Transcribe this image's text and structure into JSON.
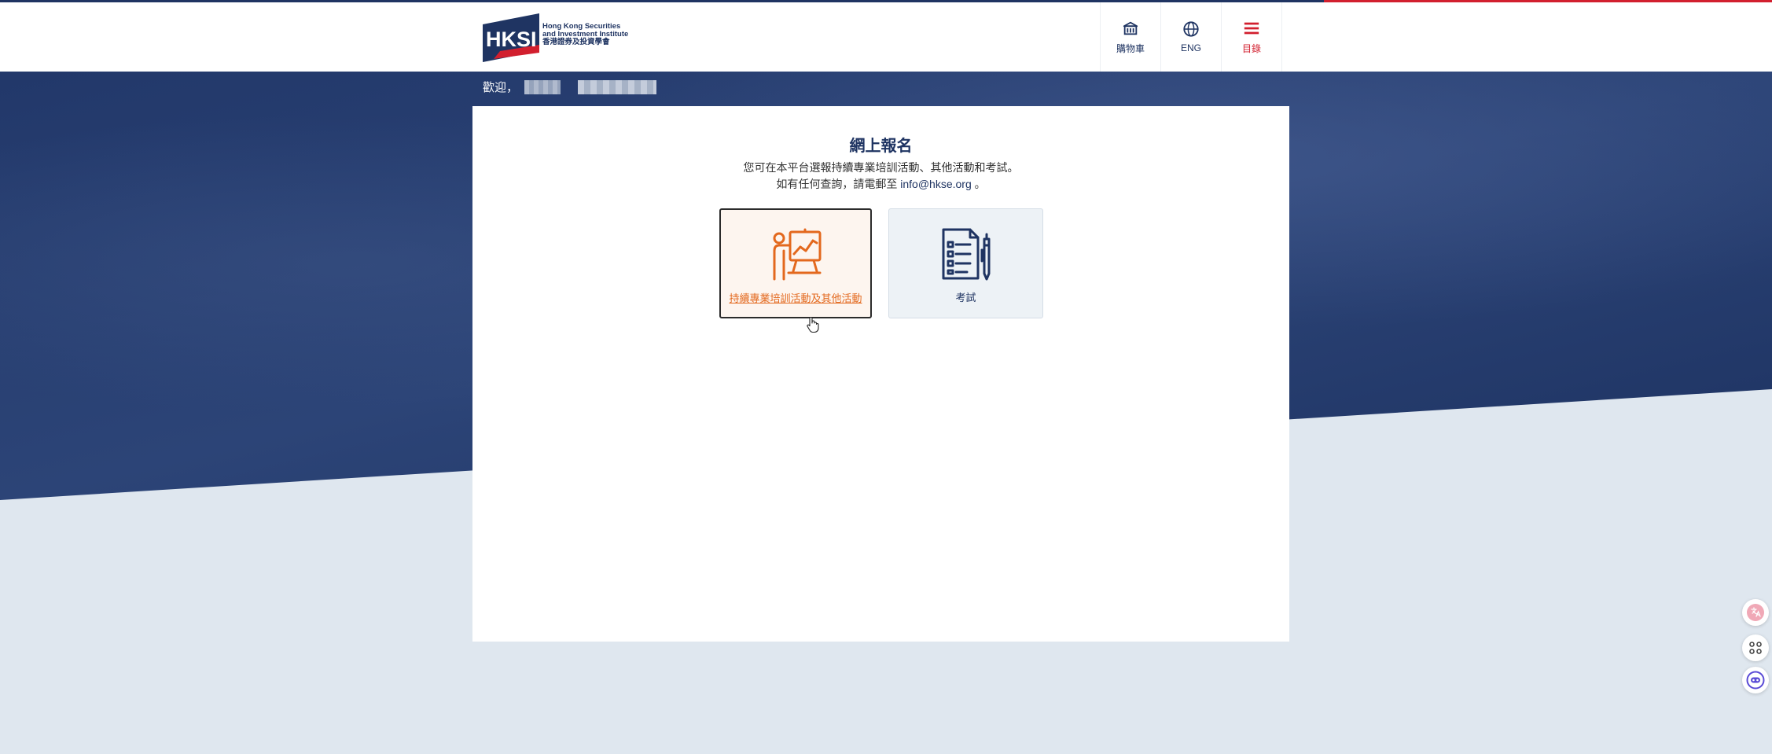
{
  "header": {
    "logo": {
      "mark_text": "HKSI",
      "name_line1": "Hong Kong Securities",
      "name_line2": "and Investment Institute",
      "name_zh": "香港證券及投資學會"
    },
    "nav": {
      "cart_label": "購物車",
      "lang_label": "ENG",
      "menu_label": "目錄"
    }
  },
  "welcome": {
    "label": "歡迎，"
  },
  "card": {
    "title": "網上報名",
    "desc_line1": "您可在本平台選報持續專業培訓活動、其他活動和考試。",
    "desc_line2_prefix": "如有任何查詢，請電郵至",
    "email": "info@hkse.org",
    "desc_line2_suffix": "。",
    "options": [
      {
        "label": "持續專業培訓活動及其他活動",
        "icon": "presentation-icon"
      },
      {
        "label": "考試",
        "icon": "checklist-icon"
      }
    ]
  },
  "colors": {
    "brand_navy": "#1f3462",
    "brand_red": "#d21f2e",
    "accent_orange": "#e3681d"
  }
}
